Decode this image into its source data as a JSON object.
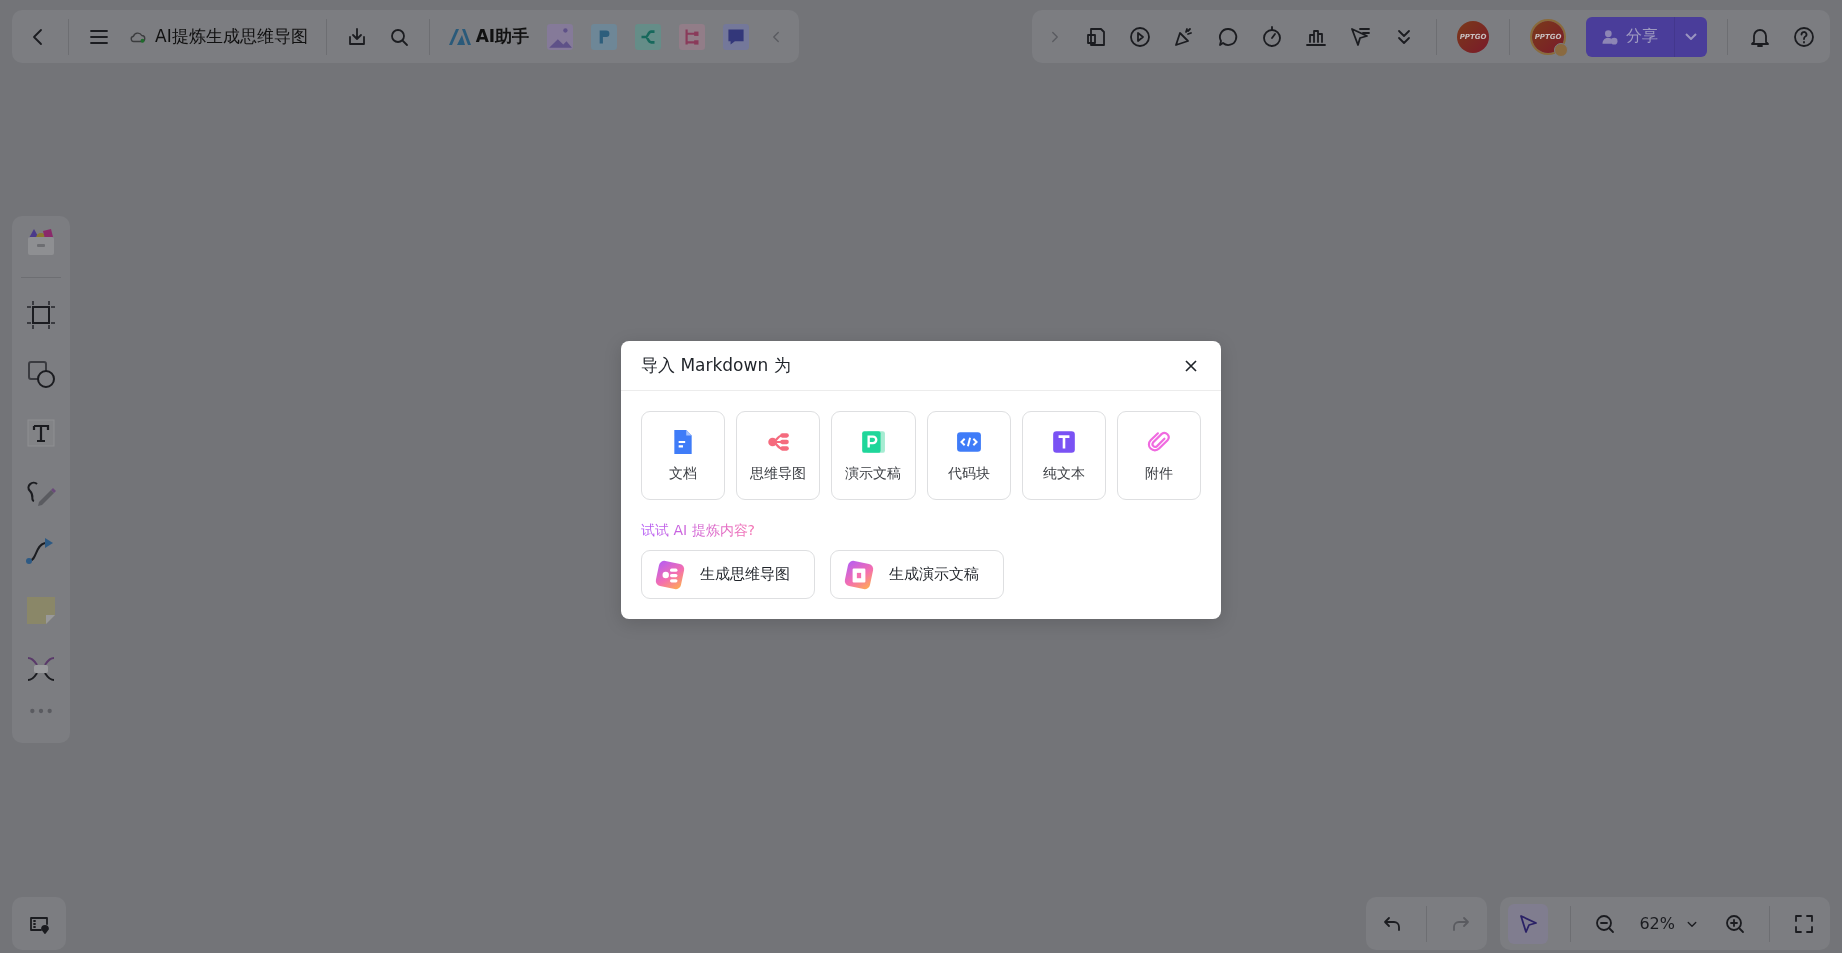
{
  "top_toolbar": {
    "title": "AI提炼生成思维导图",
    "assistant": "AI助手"
  },
  "top_right": {
    "avatars": [
      {
        "label": "PPTGO",
        "kind": "plain"
      },
      {
        "label": "PPTGO",
        "kind": "badged"
      }
    ],
    "share": "分享"
  },
  "dialog": {
    "title": "导入 Markdown 为",
    "options": [
      {
        "label": "文档",
        "kind": "doc"
      },
      {
        "label": "思维导图",
        "kind": "mindmap"
      },
      {
        "label": "演示文稿",
        "kind": "slides"
      },
      {
        "label": "代码块",
        "kind": "code"
      },
      {
        "label": "纯文本",
        "kind": "text"
      },
      {
        "label": "附件",
        "kind": "attach"
      }
    ],
    "ai_hint": "试试 AI 提炼内容?",
    "ai_actions": [
      {
        "label": "生成思维导图",
        "kind": "mindmap"
      },
      {
        "label": "生成演示文稿",
        "kind": "slides"
      }
    ]
  },
  "bottom_bar": {
    "select_tool": {
      "selected": true
    },
    "zoom": "62%"
  }
}
